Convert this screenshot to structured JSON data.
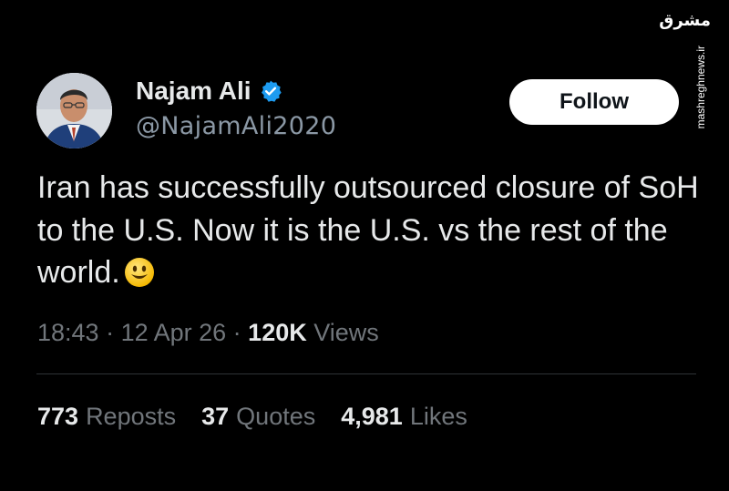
{
  "author": {
    "name": "Najam Ali",
    "handle": "@NajamAli2020",
    "verified_icon": "verified-badge-icon",
    "verified_color": "#1d9bf0"
  },
  "follow_button": {
    "label": "Follow"
  },
  "watermark": {
    "logo": "مشرق",
    "url": "mashreghnews.ir"
  },
  "tweet": {
    "text": "Iran has successfully outsourced closure of SoH to the U.S.  Now it is the U.S. vs the rest of the world.",
    "emoji": "smiley-face-emoji"
  },
  "meta": {
    "time": "18:43",
    "sep1": " · ",
    "date": "12 Apr 26",
    "sep2": " · ",
    "views_count": "120K",
    "views_label": " Views"
  },
  "stats": {
    "reposts": {
      "count": "773",
      "label": "Reposts"
    },
    "quotes": {
      "count": "37",
      "label": "Quotes"
    },
    "likes": {
      "count": "4,981",
      "label": "Likes"
    }
  },
  "colors": {
    "background": "#000000",
    "primary_text": "#e7e9ea",
    "secondary_text": "#71767b",
    "divider": "#2f3336",
    "follow_bg": "#ffffff"
  }
}
